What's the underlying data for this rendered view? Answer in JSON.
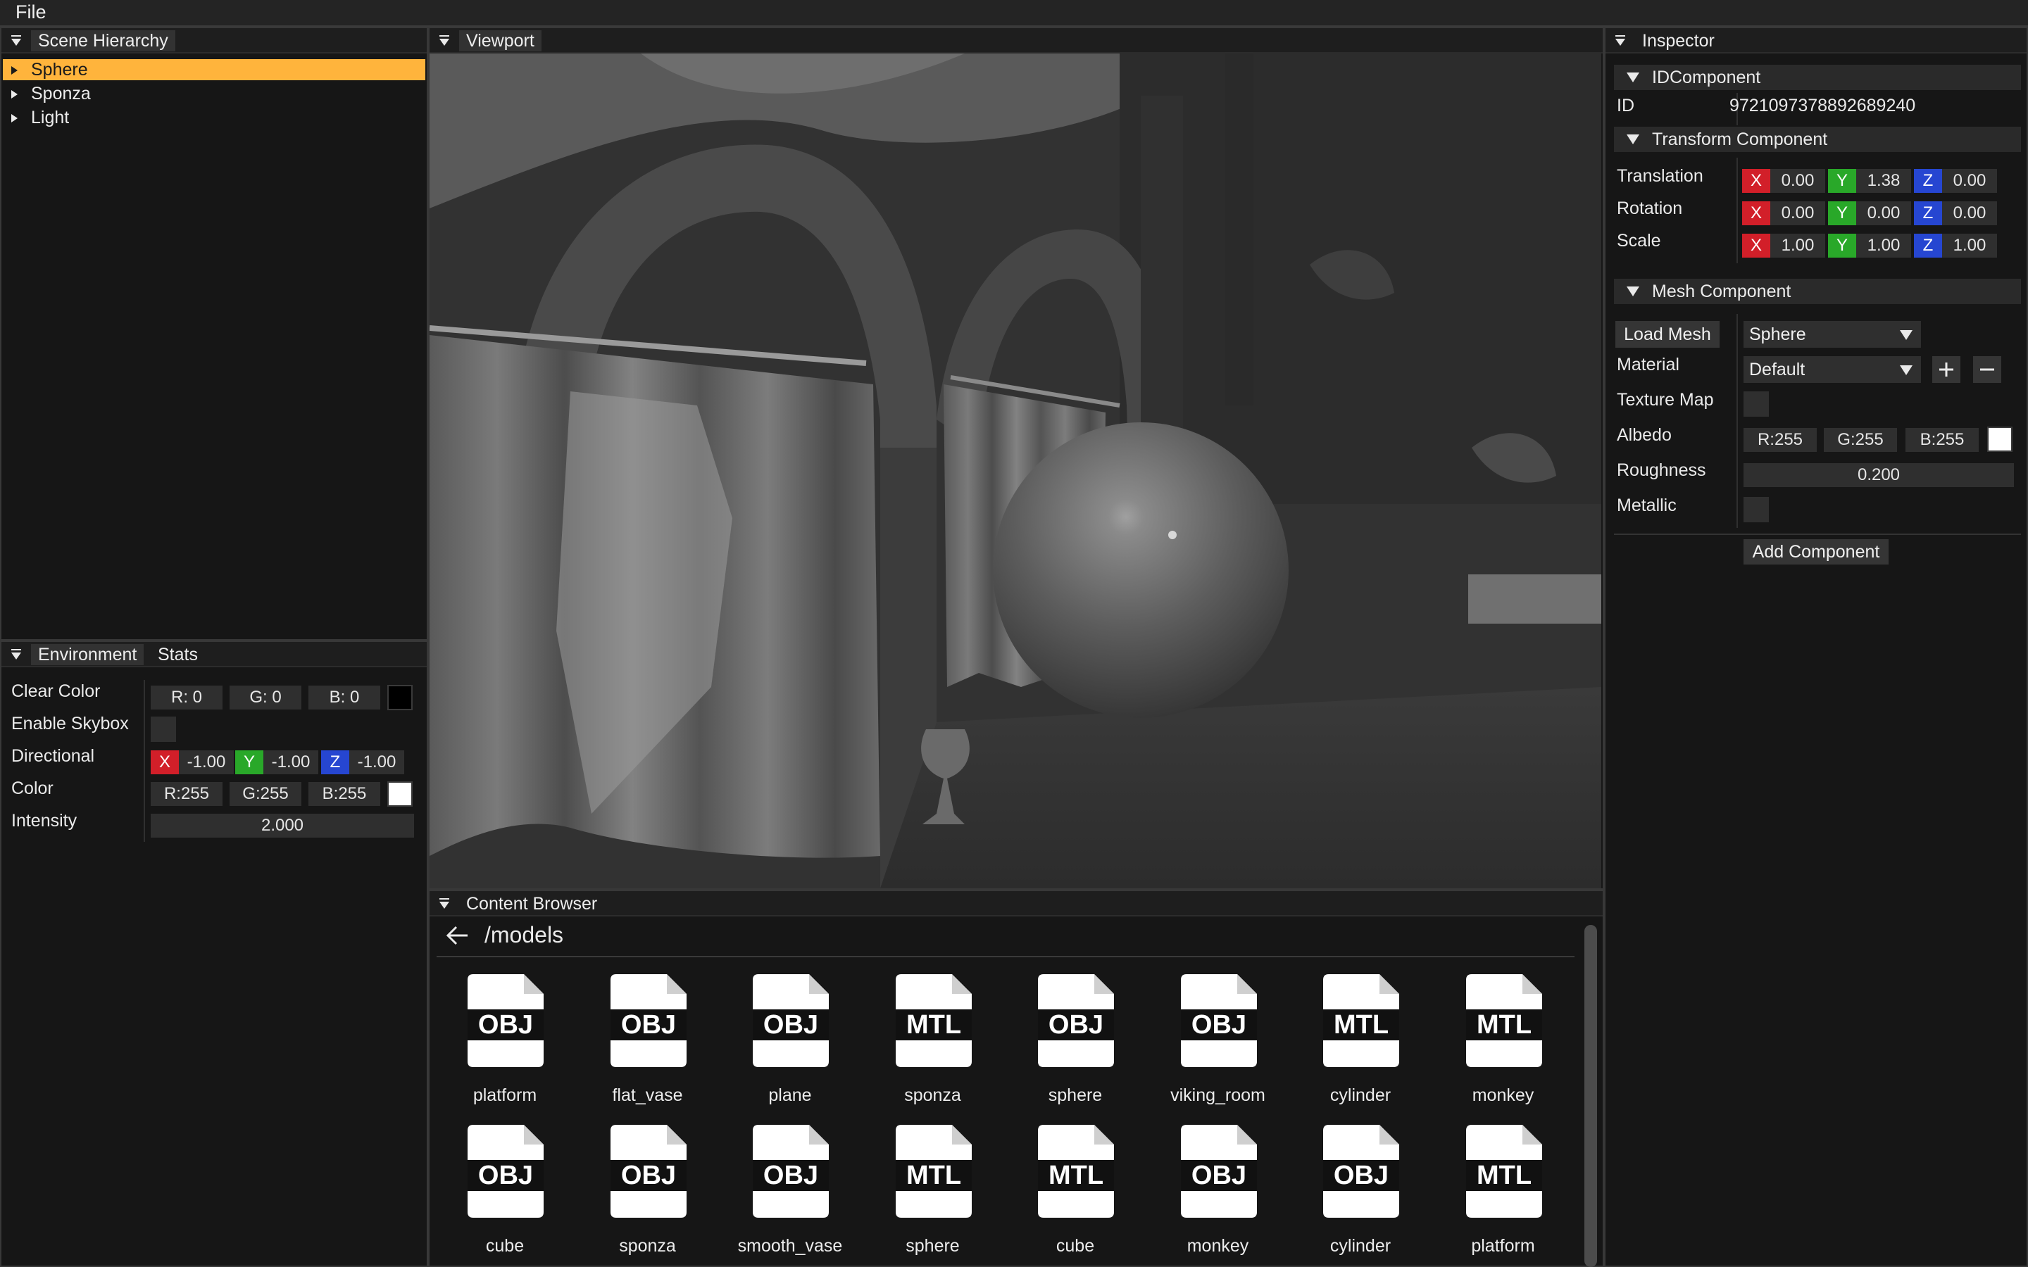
{
  "menu": {
    "file": "File"
  },
  "hierarchy": {
    "title": "Scene Hierarchy",
    "items": [
      {
        "label": "Sphere",
        "selected": true
      },
      {
        "label": "Sponza",
        "selected": false
      },
      {
        "label": "Light",
        "selected": false
      }
    ]
  },
  "environment": {
    "tabs": [
      "Environment",
      "Stats"
    ],
    "clear_color_label": "Clear Color",
    "clear_color": {
      "r": "R: 0",
      "g": "G: 0",
      "b": "B: 0",
      "swatch": "#000000"
    },
    "enable_skybox_label": "Enable Skybox",
    "directional_label": "Directional",
    "directional": {
      "x_tag": "X",
      "x": "-1.00",
      "y_tag": "Y",
      "y": "-1.00",
      "z_tag": "Z",
      "z": "-1.00"
    },
    "color_label": "Color",
    "color": {
      "r": "R:255",
      "g": "G:255",
      "b": "B:255",
      "swatch": "#ffffff"
    },
    "intensity_label": "Intensity",
    "intensity": "2.000"
  },
  "viewport": {
    "title": "Viewport"
  },
  "inspector": {
    "title": "Inspector",
    "id_component": {
      "header": "IDComponent",
      "id_label": "ID",
      "id_value": "9721097378892689240"
    },
    "transform": {
      "header": "Transform Component",
      "translation_label": "Translation",
      "translation": {
        "x": "0.00",
        "y": "1.38",
        "z": "0.00"
      },
      "rotation_label": "Rotation",
      "rotation": {
        "x": "0.00",
        "y": "0.00",
        "z": "0.00"
      },
      "scale_label": "Scale",
      "scale": {
        "x": "1.00",
        "y": "1.00",
        "z": "1.00"
      },
      "x_tag": "X",
      "y_tag": "Y",
      "z_tag": "Z"
    },
    "mesh": {
      "header": "Mesh Component",
      "load_mesh_button": "Load Mesh",
      "mesh_select": "Sphere",
      "material_label": "Material",
      "material_select": "Default",
      "texture_map_label": "Texture Map",
      "albedo_label": "Albedo",
      "albedo": {
        "r": "R:255",
        "g": "G:255",
        "b": "B:255",
        "swatch": "#ffffff"
      },
      "roughness_label": "Roughness",
      "roughness": "0.200",
      "metallic_label": "Metallic"
    },
    "add_component_button": "Add Component"
  },
  "content_browser": {
    "title": "Content Browser",
    "path": "/models",
    "files": [
      {
        "type": "OBJ",
        "name": "platform"
      },
      {
        "type": "OBJ",
        "name": "flat_vase"
      },
      {
        "type": "OBJ",
        "name": "plane"
      },
      {
        "type": "MTL",
        "name": "sponza"
      },
      {
        "type": "OBJ",
        "name": "sphere"
      },
      {
        "type": "OBJ",
        "name": "viking_room"
      },
      {
        "type": "MTL",
        "name": "cylinder"
      },
      {
        "type": "MTL",
        "name": "monkey"
      },
      {
        "type": "OBJ",
        "name": "cube"
      },
      {
        "type": "OBJ",
        "name": "sponza"
      },
      {
        "type": "OBJ",
        "name": "smooth_vase"
      },
      {
        "type": "MTL",
        "name": "sphere"
      },
      {
        "type": "MTL",
        "name": "cube"
      },
      {
        "type": "OBJ",
        "name": "monkey"
      },
      {
        "type": "OBJ",
        "name": "cylinder"
      },
      {
        "type": "MTL",
        "name": "platform"
      }
    ]
  },
  "colors": {
    "selection": "#ffb43c",
    "axis_x": "#d21f29",
    "axis_y": "#29a829",
    "axis_z": "#2646d1"
  }
}
